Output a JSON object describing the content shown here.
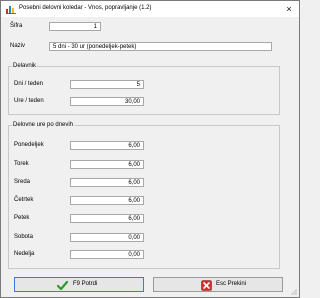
{
  "window": {
    "title": "Posebni delovni koledar - Vnos, popravljanje (1.2)",
    "close_glyph": "×"
  },
  "header": {
    "sifra_label": "Šifra",
    "sifra_value": "1",
    "naziv_label": "Naziv",
    "naziv_value": "5 dni - 30 ur (ponedeljek-petek)"
  },
  "delavnik": {
    "title": "Delavnik",
    "dni_label": "Dni / teden",
    "dni_value": "5",
    "ure_label": "Ure / teden",
    "ure_value": "30,00"
  },
  "delovne_ure": {
    "title": "Delovne ure po dnevih",
    "days": [
      {
        "label": "Ponedeljek",
        "value": "6,00"
      },
      {
        "label": "Torek",
        "value": "6,00"
      },
      {
        "label": "Sreda",
        "value": "6,00"
      },
      {
        "label": "Četrtek",
        "value": "6,00"
      },
      {
        "label": "Petek",
        "value": "6,00"
      },
      {
        "label": "Sobota",
        "value": "0,00"
      },
      {
        "label": "Nedelja",
        "value": "0,00"
      }
    ]
  },
  "buttons": {
    "confirm_label": "F9 Potrdi",
    "cancel_label": "Esc Prekini"
  },
  "icons": {
    "app": "calendar-app-icon",
    "confirm": "green-checkmark-icon",
    "cancel": "red-x-icon"
  },
  "colors": {
    "confirm_check": "#2a9d2a",
    "cancel_x": "#d42b2b",
    "focus_border": "#3b7ad6"
  }
}
